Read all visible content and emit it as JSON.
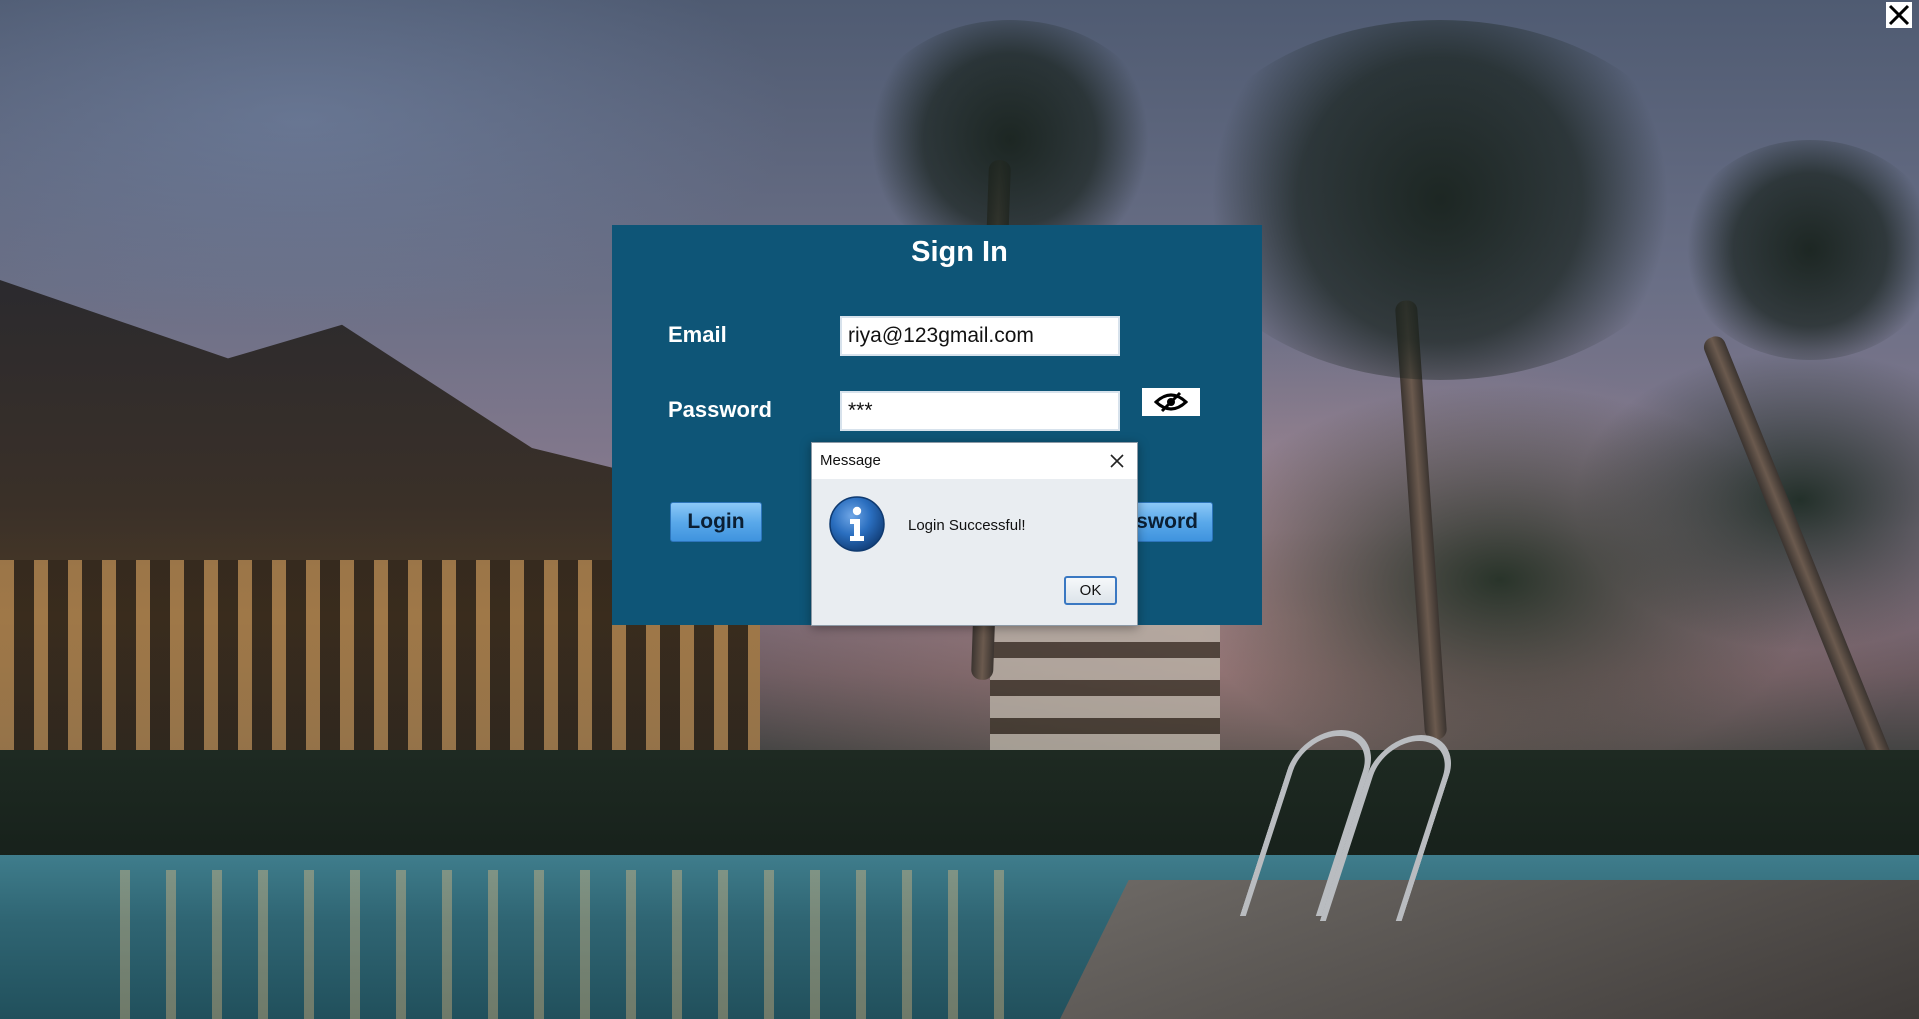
{
  "signin": {
    "title": "Sign In",
    "email_label": "Email",
    "email_value": "riya@123gmail.com",
    "password_label": "Password",
    "password_value": "***",
    "login_label": "Login",
    "forgot_label_visible": "sword"
  },
  "dialog": {
    "title": "Message",
    "message": "Login Successful!",
    "ok_label": "OK"
  },
  "icons": {
    "app_close": "close-icon",
    "password_toggle": "eye-slash-icon",
    "dialog_close": "close-icon",
    "dialog_info": "info-icon"
  },
  "colors": {
    "panel": "#0e5577",
    "button": "#5aa9ea",
    "dialog_bg": "#e9edf1",
    "info_icon": "#1f5fae"
  }
}
